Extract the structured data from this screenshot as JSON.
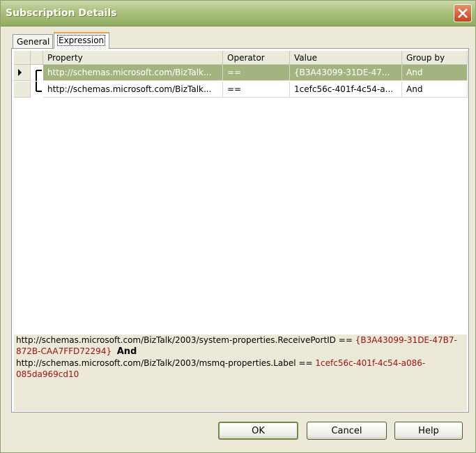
{
  "window": {
    "title": "Subscription Details"
  },
  "tabs": [
    {
      "label": "General",
      "active": false
    },
    {
      "label": "Expression",
      "active": true
    }
  ],
  "grid": {
    "columns": [
      "Property",
      "Operator",
      "Value",
      "Group by"
    ],
    "rows": [
      {
        "property": "http://schemas.microsoft.com/BizTalk...",
        "operator": "==",
        "value": "{B3A43099-31DE-47...",
        "group_by": "And",
        "selected": true
      },
      {
        "property": "http://schemas.microsoft.com/BizTalk...",
        "operator": "==",
        "value": "1cefc56c-401f-4c54-a...",
        "group_by": "And",
        "selected": false
      }
    ]
  },
  "summary": {
    "line1_prop": "http://schemas.microsoft.com/BizTalk/2003/system-properties.ReceivePortID",
    "line1_op": "==",
    "line1_val_a": "{B3A43099-31DE-47B7-",
    "line1_val_b": "872B-CAA7FFD72294}",
    "joiner": "And",
    "line2_prop": "http://schemas.microsoft.com/BizTalk/2003/msmq-properties.Label",
    "line2_op": "==",
    "line2_val_a": "1cefc56c-401f-4c54-a086-",
    "line2_val_b": "085da969cd10"
  },
  "buttons": {
    "ok": "OK",
    "cancel": "Cancel",
    "help": "Help"
  },
  "colors": {
    "title_bar": "#a9c07a",
    "selected_row": "#a3b481",
    "value_text": "#a01010",
    "tab_accent": "#e6a243"
  }
}
